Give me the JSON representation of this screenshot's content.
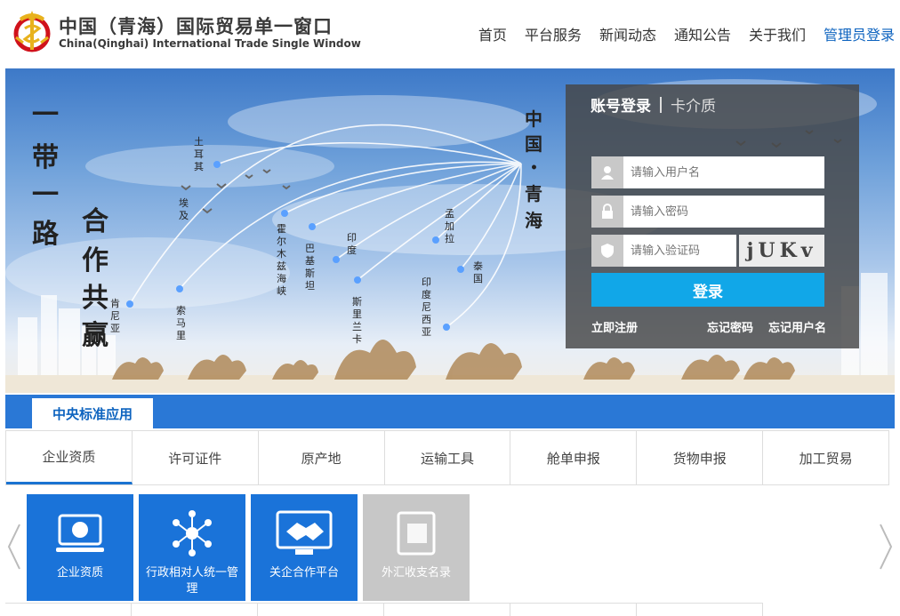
{
  "header": {
    "title_cn": "中国（青海）国际贸易单一窗口",
    "title_en": "China(Qinghai) International Trade Single Window"
  },
  "nav": {
    "items": [
      "首页",
      "平台服务",
      "新闻动态",
      "通知公告",
      "关于我们"
    ],
    "admin": "管理员登录"
  },
  "banner": {
    "slogan": [
      "一带一路",
      "合作共赢"
    ],
    "origin": "中国 · 青海",
    "places": [
      "土耳其",
      "埃及",
      "肯尼亚",
      "索马里",
      "霍尔木兹海峡",
      "巴基斯坦",
      "印度",
      "斯里兰卡",
      "孟加拉",
      "泰国",
      "印度尼西亚"
    ]
  },
  "login": {
    "tab_active": "账号登录",
    "tab_other": "卡介质",
    "username_placeholder": "请输入用户名",
    "password_placeholder": "请输入密码",
    "captcha_placeholder": "请输入验证码",
    "captcha_text": "jUKv",
    "submit": "登录",
    "register": "立即注册",
    "forgot_password": "忘记密码",
    "forgot_username": "忘记用户名"
  },
  "section": {
    "tab": "中央标准应用"
  },
  "categories": [
    "企业资质",
    "许可证件",
    "原产地",
    "运输工具",
    "舱单申报",
    "货物申报",
    "加工贸易"
  ],
  "tiles": [
    "企业资质",
    "行政相对人统一管理",
    "关企合作平台",
    "外汇收支名录"
  ],
  "colors": {
    "primary": "#1a73d9",
    "accent": "#11a7e8",
    "bar": "#2a78d6"
  }
}
